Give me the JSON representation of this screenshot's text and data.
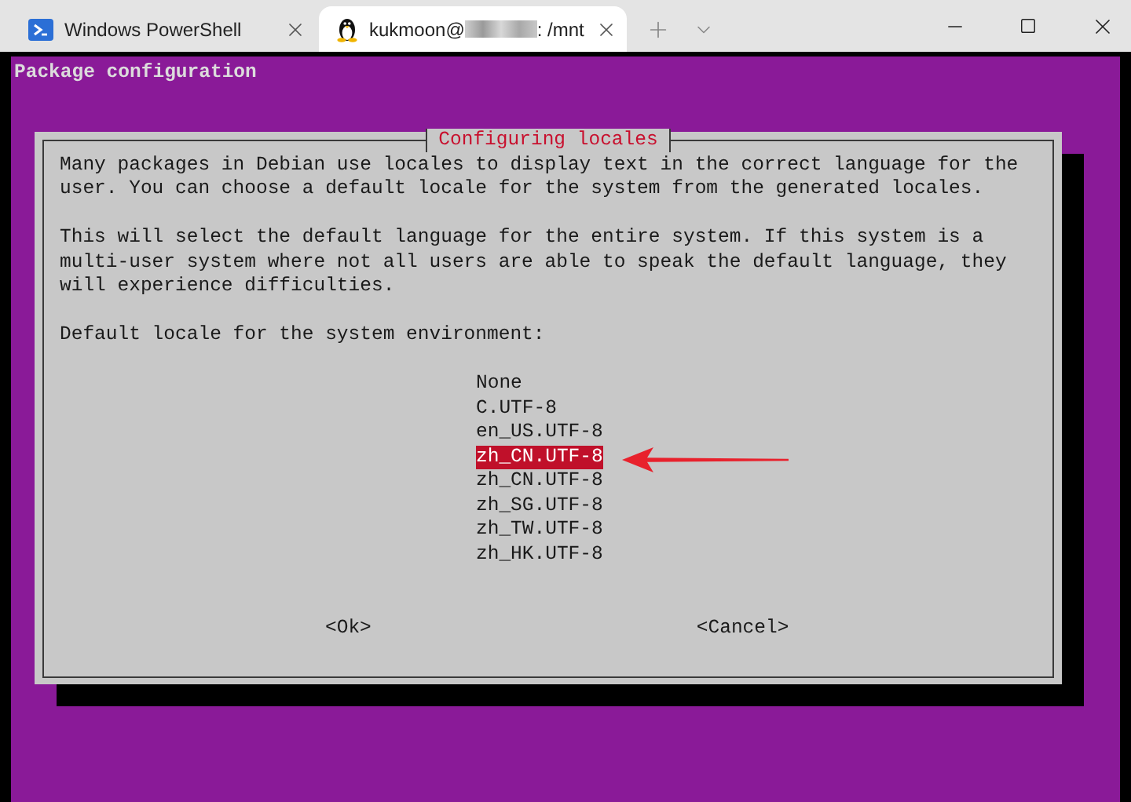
{
  "tabs": [
    {
      "kind": "powershell",
      "title": "Windows PowerShell",
      "selected": false
    },
    {
      "kind": "linux",
      "title": "kukmoon@",
      "redacted": true,
      "suffix": ": /mnt",
      "selected": true
    }
  ],
  "terminal": {
    "header": "Package configuration",
    "dialog": {
      "title": "Configuring locales",
      "paragraphs": [
        [
          "Many packages in Debian use locales to display text in the correct language for the",
          "user. You can choose a default locale for the system from the generated locales."
        ],
        [
          "This will select the default language for the entire system. If this system is a",
          "multi-user system where not all users are able to speak the default language, they",
          "will experience difficulties."
        ]
      ],
      "prompt": "Default locale for the system environment:",
      "options": [
        {
          "label": "None",
          "selected": false
        },
        {
          "label": "C.UTF-8",
          "selected": false
        },
        {
          "label": "en_US.UTF-8",
          "selected": false
        },
        {
          "label": "zh_CN.UTF-8",
          "selected": true
        },
        {
          "label": "zh_CN.UTF-8",
          "selected": false
        },
        {
          "label": "zh_SG.UTF-8",
          "selected": false
        },
        {
          "label": "zh_TW.UTF-8",
          "selected": false
        },
        {
          "label": "zh_HK.UTF-8",
          "selected": false
        }
      ],
      "buttons": [
        "<Ok>",
        "<Cancel>"
      ]
    }
  }
}
